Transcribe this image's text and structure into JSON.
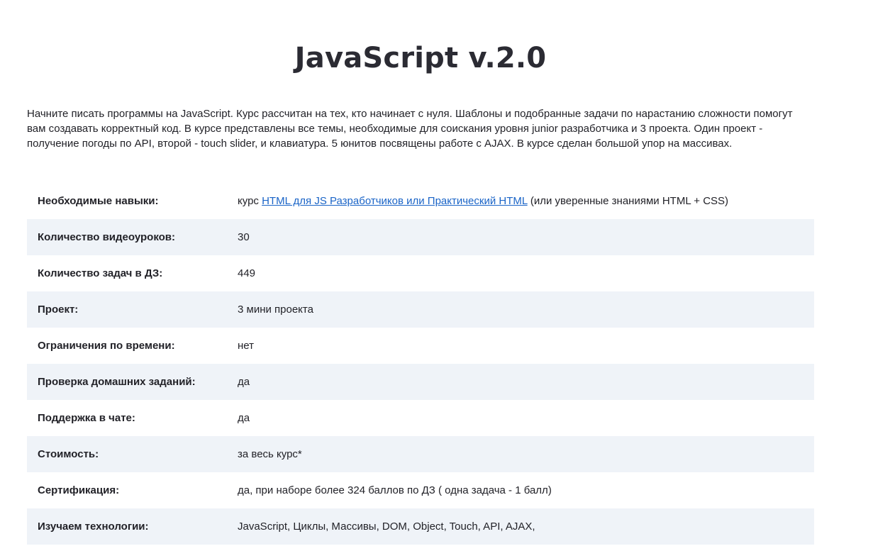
{
  "title": "JavaScript v.2.0",
  "intro": "Начните писать программы на JavaScript. Курс рассчитан на тех, кто начинает с нуля. Шаблоны и подобранные задачи по нарастанию сложности помогут вам создавать корректный код. В курсе представлены все темы, необходимые для соискания уровня junior разработчика и 3 проекта. Один проект - получение погоды по API, второй - touch slider, и клавиатура. 5 юнитов посвящены работе с AJAX. В курсе сделан большой упор на массивах.",
  "colors": {
    "title": "#2b2b33",
    "text": "#222228",
    "link": "#1a64c7",
    "row_alt_bg": "#eff3f8"
  },
  "specs": {
    "skills": {
      "label": "Необходимые навыки:",
      "prefix": "курс ",
      "link_text": "HTML для JS Разработчиков или Практический HTML",
      "suffix": " (или уверенные знаниями HTML + CSS)"
    },
    "videos": {
      "label": "Количество видеоуроков:",
      "value": "30"
    },
    "tasks": {
      "label": "Количество задач в ДЗ:",
      "value": "449"
    },
    "project": {
      "label": "Проект:",
      "value": "3 мини проекта"
    },
    "time_limit": {
      "label": "Ограничения по времени:",
      "value": "нет"
    },
    "homework_review": {
      "label": "Проверка домашних заданий:",
      "value": "да"
    },
    "chat_support": {
      "label": "Поддержка в чате:",
      "value": "да"
    },
    "price": {
      "label": "Стоимость:",
      "value": "за весь курс*"
    },
    "certification": {
      "label": "Сертификация:",
      "value": "да, при наборе более 324 баллов по ДЗ ( одна задача - 1 балл)"
    },
    "technologies": {
      "label": "Изучаем технологии:",
      "value": "JavaScript, Циклы, Массивы, DOM, Object, Touch, API, AJAX,"
    }
  }
}
